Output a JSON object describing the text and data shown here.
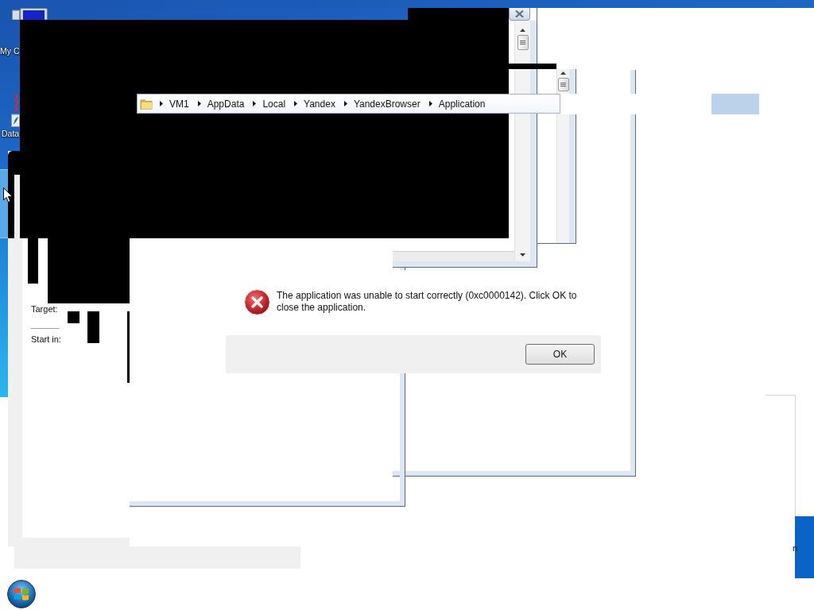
{
  "desktop": {
    "icons": [
      {
        "kind": "computer",
        "label": "My C"
      },
      {
        "kind": "shortcut",
        "label": "Data"
      }
    ]
  },
  "address_bar": {
    "path": [
      "VM1",
      "AppData",
      "Local",
      "Yandex",
      "YandexBrowser",
      "Application"
    ]
  },
  "properties": {
    "fields": [
      {
        "label": "Target:"
      },
      {
        "label": "Start in:"
      }
    ]
  },
  "error_dialog": {
    "message": "The application was unable to start correctly (0xc0000142). Click OK to close the application.",
    "buttons": [
      "OK"
    ]
  },
  "side_window": {
    "text": "n"
  }
}
